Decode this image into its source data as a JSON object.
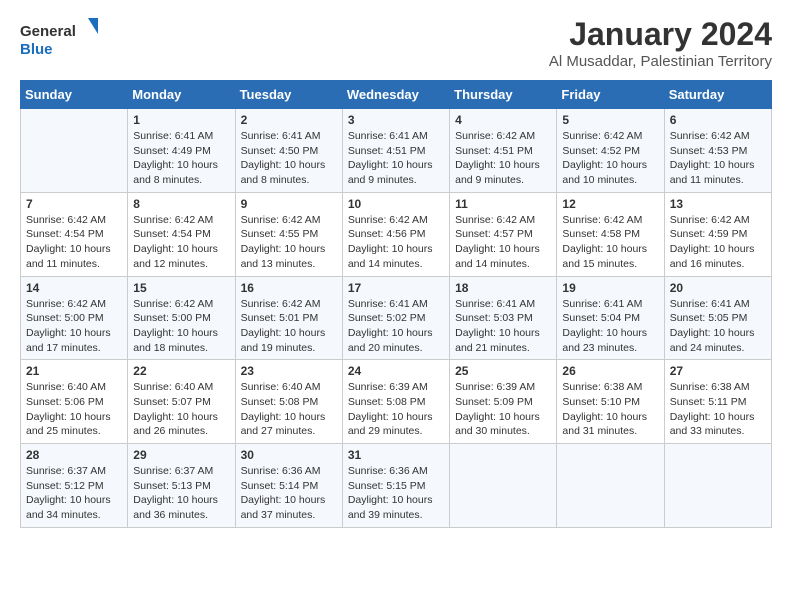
{
  "header": {
    "logo_line1": "General",
    "logo_line2": "Blue",
    "month_title": "January 2024",
    "location": "Al Musaddar, Palestinian Territory"
  },
  "weekdays": [
    "Sunday",
    "Monday",
    "Tuesday",
    "Wednesday",
    "Thursday",
    "Friday",
    "Saturday"
  ],
  "weeks": [
    [
      {
        "day": "",
        "info": ""
      },
      {
        "day": "1",
        "info": "Sunrise: 6:41 AM\nSunset: 4:49 PM\nDaylight: 10 hours\nand 8 minutes."
      },
      {
        "day": "2",
        "info": "Sunrise: 6:41 AM\nSunset: 4:50 PM\nDaylight: 10 hours\nand 8 minutes."
      },
      {
        "day": "3",
        "info": "Sunrise: 6:41 AM\nSunset: 4:51 PM\nDaylight: 10 hours\nand 9 minutes."
      },
      {
        "day": "4",
        "info": "Sunrise: 6:42 AM\nSunset: 4:51 PM\nDaylight: 10 hours\nand 9 minutes."
      },
      {
        "day": "5",
        "info": "Sunrise: 6:42 AM\nSunset: 4:52 PM\nDaylight: 10 hours\nand 10 minutes."
      },
      {
        "day": "6",
        "info": "Sunrise: 6:42 AM\nSunset: 4:53 PM\nDaylight: 10 hours\nand 11 minutes."
      }
    ],
    [
      {
        "day": "7",
        "info": "Sunrise: 6:42 AM\nSunset: 4:54 PM\nDaylight: 10 hours\nand 11 minutes."
      },
      {
        "day": "8",
        "info": "Sunrise: 6:42 AM\nSunset: 4:54 PM\nDaylight: 10 hours\nand 12 minutes."
      },
      {
        "day": "9",
        "info": "Sunrise: 6:42 AM\nSunset: 4:55 PM\nDaylight: 10 hours\nand 13 minutes."
      },
      {
        "day": "10",
        "info": "Sunrise: 6:42 AM\nSunset: 4:56 PM\nDaylight: 10 hours\nand 14 minutes."
      },
      {
        "day": "11",
        "info": "Sunrise: 6:42 AM\nSunset: 4:57 PM\nDaylight: 10 hours\nand 14 minutes."
      },
      {
        "day": "12",
        "info": "Sunrise: 6:42 AM\nSunset: 4:58 PM\nDaylight: 10 hours\nand 15 minutes."
      },
      {
        "day": "13",
        "info": "Sunrise: 6:42 AM\nSunset: 4:59 PM\nDaylight: 10 hours\nand 16 minutes."
      }
    ],
    [
      {
        "day": "14",
        "info": "Sunrise: 6:42 AM\nSunset: 5:00 PM\nDaylight: 10 hours\nand 17 minutes."
      },
      {
        "day": "15",
        "info": "Sunrise: 6:42 AM\nSunset: 5:00 PM\nDaylight: 10 hours\nand 18 minutes."
      },
      {
        "day": "16",
        "info": "Sunrise: 6:42 AM\nSunset: 5:01 PM\nDaylight: 10 hours\nand 19 minutes."
      },
      {
        "day": "17",
        "info": "Sunrise: 6:41 AM\nSunset: 5:02 PM\nDaylight: 10 hours\nand 20 minutes."
      },
      {
        "day": "18",
        "info": "Sunrise: 6:41 AM\nSunset: 5:03 PM\nDaylight: 10 hours\nand 21 minutes."
      },
      {
        "day": "19",
        "info": "Sunrise: 6:41 AM\nSunset: 5:04 PM\nDaylight: 10 hours\nand 23 minutes."
      },
      {
        "day": "20",
        "info": "Sunrise: 6:41 AM\nSunset: 5:05 PM\nDaylight: 10 hours\nand 24 minutes."
      }
    ],
    [
      {
        "day": "21",
        "info": "Sunrise: 6:40 AM\nSunset: 5:06 PM\nDaylight: 10 hours\nand 25 minutes."
      },
      {
        "day": "22",
        "info": "Sunrise: 6:40 AM\nSunset: 5:07 PM\nDaylight: 10 hours\nand 26 minutes."
      },
      {
        "day": "23",
        "info": "Sunrise: 6:40 AM\nSunset: 5:08 PM\nDaylight: 10 hours\nand 27 minutes."
      },
      {
        "day": "24",
        "info": "Sunrise: 6:39 AM\nSunset: 5:08 PM\nDaylight: 10 hours\nand 29 minutes."
      },
      {
        "day": "25",
        "info": "Sunrise: 6:39 AM\nSunset: 5:09 PM\nDaylight: 10 hours\nand 30 minutes."
      },
      {
        "day": "26",
        "info": "Sunrise: 6:38 AM\nSunset: 5:10 PM\nDaylight: 10 hours\nand 31 minutes."
      },
      {
        "day": "27",
        "info": "Sunrise: 6:38 AM\nSunset: 5:11 PM\nDaylight: 10 hours\nand 33 minutes."
      }
    ],
    [
      {
        "day": "28",
        "info": "Sunrise: 6:37 AM\nSunset: 5:12 PM\nDaylight: 10 hours\nand 34 minutes."
      },
      {
        "day": "29",
        "info": "Sunrise: 6:37 AM\nSunset: 5:13 PM\nDaylight: 10 hours\nand 36 minutes."
      },
      {
        "day": "30",
        "info": "Sunrise: 6:36 AM\nSunset: 5:14 PM\nDaylight: 10 hours\nand 37 minutes."
      },
      {
        "day": "31",
        "info": "Sunrise: 6:36 AM\nSunset: 5:15 PM\nDaylight: 10 hours\nand 39 minutes."
      },
      {
        "day": "",
        "info": ""
      },
      {
        "day": "",
        "info": ""
      },
      {
        "day": "",
        "info": ""
      }
    ]
  ]
}
